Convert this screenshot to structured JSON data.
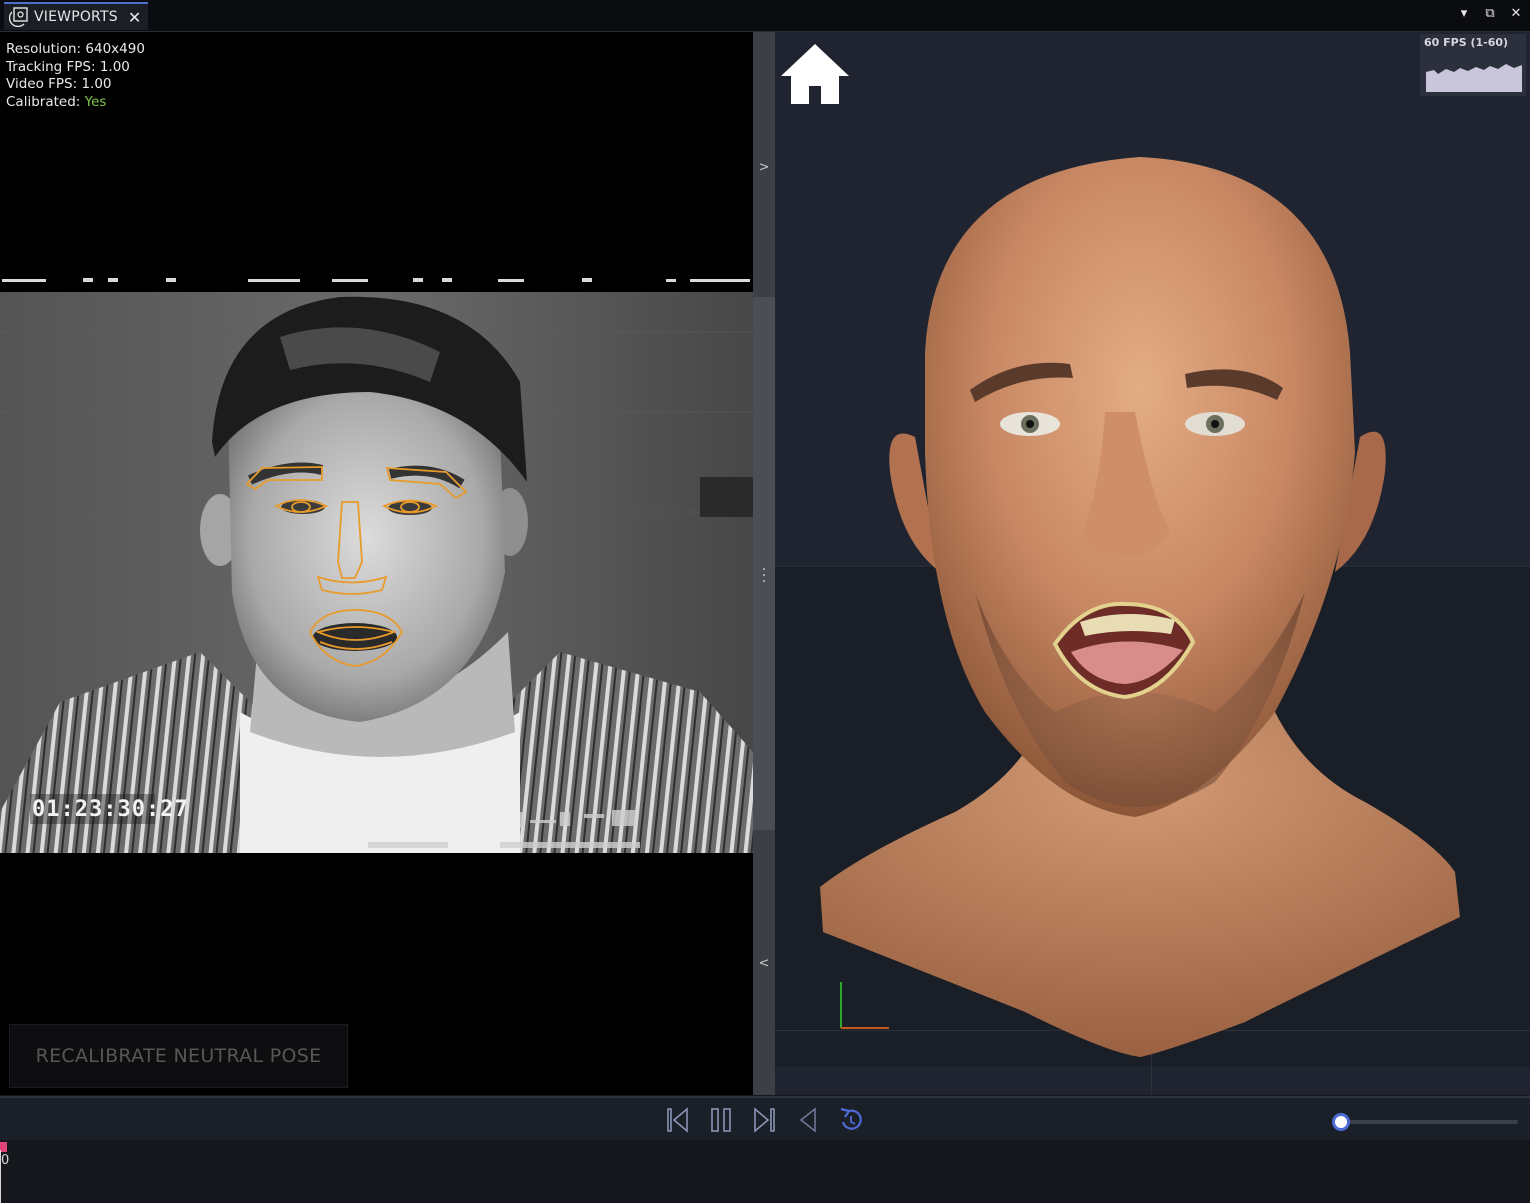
{
  "tab": {
    "label": "VIEWPORTS",
    "close": "✕"
  },
  "window_controls": {
    "dropdown": "▾",
    "restore": "⧉",
    "close": "✕"
  },
  "video_info": {
    "resolution_label": "Resolution:",
    "resolution": "640x490",
    "tracking_label": "Tracking FPS:",
    "tracking_fps": "1.00",
    "video_label": "Video FPS:",
    "video_fps": "1.00",
    "calibrated_label": "Calibrated:",
    "calibrated": "Yes"
  },
  "video_timecode": "01:23:30:27",
  "recalibrate_button": "RECALIBRATE NEUTRAL POSE",
  "splitter": {
    "expand_arrow": ">",
    "collapse_arrow": "<"
  },
  "viewport": {
    "fps_label": "60 FPS (1-60)"
  },
  "transport": {
    "volume": 0.0
  },
  "timeline": {
    "frame_label": "0"
  },
  "colors": {
    "accent": "#4d6bd6",
    "tracking_overlay": "#e89a2a",
    "calibrated": "#7fc54a",
    "marker": "#e0457a"
  }
}
